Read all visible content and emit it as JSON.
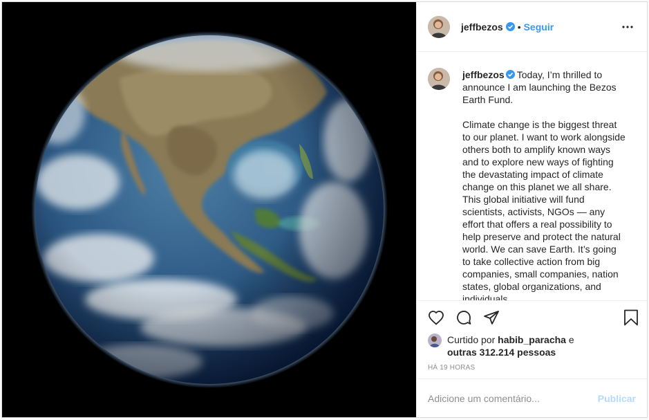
{
  "post": {
    "image_alt": "Earth from space",
    "header": {
      "username": "jeffbezos",
      "dot": "•",
      "follow_label": "Seguir",
      "more_icon": "more-horizontal-icon"
    },
    "caption": {
      "username": "jeffbezos",
      "intro": "Today, I’m thrilled to announce I am launching the Bezos Earth Fund.",
      "body": "Climate change is the biggest threat to our planet. I want to work alongside others both to amplify known ways and to explore new ways of fighting the devastating impact of climate change on this planet we all share. This global initiative will fund scientists, activists, NGOs — any effort that offers a real possibility to help preserve and protect the natural world. We can save Earth. It’s going to take collective action from big companies, small companies, nation states, global organizations, and individuals."
    },
    "actions": {
      "like_icon": "heart-icon",
      "comment_icon": "comment-icon",
      "share_icon": "share-icon",
      "save_icon": "bookmark-icon"
    },
    "likes": {
      "prefix": "Curtido por",
      "liker": "habib_paracha",
      "and": "e",
      "others": "outras 312.214 pessoas"
    },
    "time": "Há 19 horas",
    "comment": {
      "placeholder": "Adicione um comentário...",
      "publish_label": "Publicar"
    }
  },
  "colors": {
    "accent": "#3897f0",
    "publish_disabled": "#b3dbff",
    "verified": "#3897f0"
  }
}
